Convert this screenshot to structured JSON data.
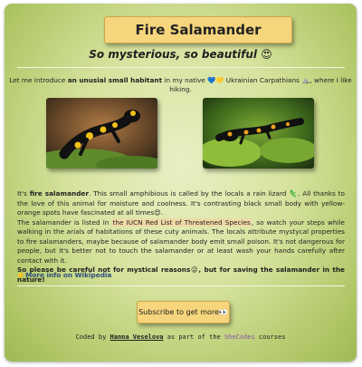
{
  "header": {
    "title": "Fire Salamander",
    "subtitle": "So mysterious, so beautiful",
    "subtitle_emoji": "😍"
  },
  "intro": {
    "part1": "Let me introduce ",
    "bold": "an unusial small habitant",
    "part2": " in my native ",
    "hearts": "💙💛",
    "part3": " Ukrainian Carpathians ",
    "mountain_emoji": "⛰️",
    "part4": ", where I like hiking."
  },
  "photos": [
    {
      "alt": "Fire salamander on moss"
    },
    {
      "alt": "Fire salamander on green moss"
    }
  ],
  "article": {
    "p1_a": "It's ",
    "p1_bold": "fire salamander",
    "p1_b": ". This small amphibious is called by the locals a rain lizard ",
    "lizard_emoji": "🦎",
    "p1_c": ". All thanks to the love of this animal for moisture and coolness. It's contrasting black small body with yellow-orange spots have fascinated at all times",
    "p1_emoji": "😍",
    "p1_end": ".",
    "p2_a": "The salamander is listed in ",
    "p2_link": "the IUCN Red List of Threatened Species",
    "p2_b": ", so watch your steps while walking in the arials of habitations of these cuty animals. The locals attribute mystycal properties to fire salamanders, maybe because of salamander body emit small poison. It's not dangerous for people, but it's better not to touch the salamander or at least wash your hands carefully after contact with it.",
    "p3_bold_a": "So please be careful not for mystical reasons",
    "p3_emoji": "😜",
    "p3_bold_b": ", but for saving the salamander in the nature!"
  },
  "wiki": {
    "emoji": "👉",
    "label": "More info on Wikipedia"
  },
  "subscribe": {
    "label": "Subscribe to get more",
    "emoji": "👀"
  },
  "footer": {
    "prefix": "Coded by ",
    "author": "Hanna Veselova",
    "middle": " as part of the ",
    "school": "SheCodes",
    "suffix": " courses"
  },
  "colors": {
    "accent": "#f7d57c",
    "background_center": "#e8f0c4",
    "background_edge": "#9fb957",
    "highlight": "#f1d9a6",
    "school_link": "#8a4fb0"
  }
}
